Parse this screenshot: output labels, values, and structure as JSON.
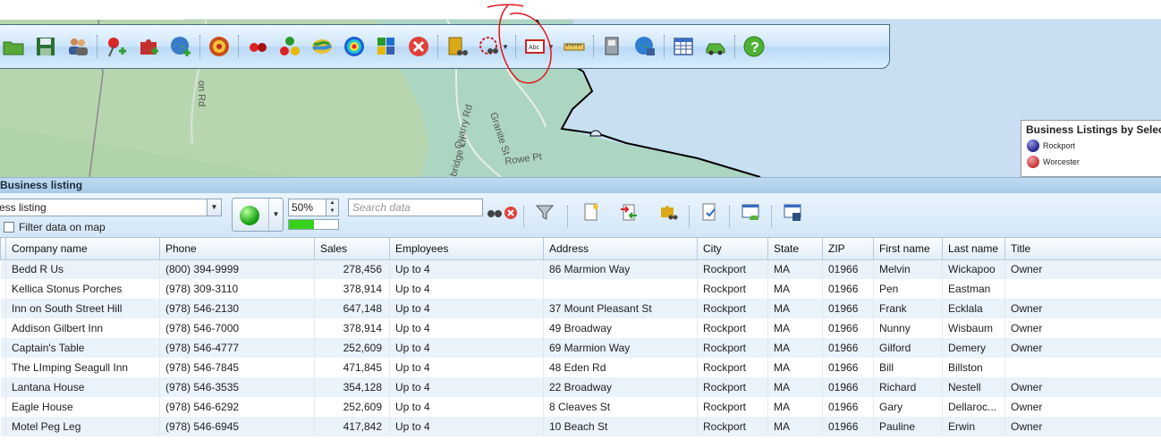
{
  "map": {
    "road_labels": [
      "on Rd",
      "Quarry Rd",
      "Granite St",
      "Rowe Pt",
      "bridge Ln"
    ],
    "colors": {
      "land": "#b5d7b0",
      "water": "#c5ddf0",
      "shore": "#000000"
    }
  },
  "toolbar": {
    "buttons": [
      {
        "name": "open-folder-icon"
      },
      {
        "name": "save-icon"
      },
      {
        "name": "users-icon"
      },
      {
        "name": "add-pushpin-icon"
      },
      {
        "name": "puzzle-add-icon"
      },
      {
        "name": "globe-add-icon"
      },
      {
        "name": "target-icon"
      },
      {
        "name": "dots-red-icon"
      },
      {
        "name": "dots-cluster-icon"
      },
      {
        "name": "shaded-area-icon"
      },
      {
        "name": "heatmap-icon"
      },
      {
        "name": "puzzle-colorful-icon"
      },
      {
        "name": "delete-icon"
      },
      {
        "name": "find-businesses-icon"
      },
      {
        "name": "radius-search-icon"
      },
      {
        "name": "label-icon"
      },
      {
        "name": "ruler-icon"
      },
      {
        "name": "print-icon"
      },
      {
        "name": "globe-export-icon"
      },
      {
        "name": "table-icon"
      },
      {
        "name": "car-icon"
      },
      {
        "name": "help-icon"
      }
    ]
  },
  "legend": {
    "title": "Business Listings by Selec",
    "items": [
      {
        "label": "Rockport",
        "color": "#2a2a8f"
      },
      {
        "label": "Worcester",
        "color": "#c83a3a"
      }
    ]
  },
  "panel": {
    "title": "Business listing",
    "layer_select": "ess listing",
    "filter_label": "Filter data on map",
    "filter_checked": false,
    "color_value": "#22b41e",
    "opacity_label": "50%",
    "opacity_fraction": 0.5,
    "search_placeholder": "Search data"
  },
  "table": {
    "columns": [
      "Company name",
      "Phone",
      "Sales",
      "Employees",
      "Address",
      "City",
      "State",
      "ZIP",
      "First name",
      "Last name",
      "Title"
    ],
    "rows": [
      [
        "Bedd R Us",
        "(800) 394-9999",
        "278,456",
        "Up to 4",
        "86 Marmion Way",
        "Rockport",
        "MA",
        "01966",
        "Melvin",
        "Wickapoo",
        "Owner"
      ],
      [
        "Kellica Stonus Porches",
        "(978) 309-3110",
        "378,914",
        "Up to 4",
        "",
        "Rockport",
        "MA",
        "01966",
        "Pen",
        "Eastman",
        ""
      ],
      [
        "Inn on South Street Hill",
        "(978) 546-2130",
        "647,148",
        "Up to 4",
        "37 Mount Pleasant St",
        "Rockport",
        "MA",
        "01966",
        "Frank",
        "Ecklala",
        "Owner"
      ],
      [
        "Addison Gilbert Inn",
        "(978) 546-7000",
        "378,914",
        "Up to 4",
        "49 Broadway",
        "Rockport",
        "MA",
        "01966",
        "Nunny",
        "Wisbaum",
        "Owner"
      ],
      [
        "Captain's Table",
        "(978) 546-4777",
        "252,609",
        "Up to 4",
        "69 Marmion Way",
        "Rockport",
        "MA",
        "01966",
        "Gilford",
        "Demery",
        "Owner"
      ],
      [
        "The LImping Seagull Inn",
        "(978) 546-7845",
        "471,845",
        "Up to 4",
        "48 Eden Rd",
        "Rockport",
        "MA",
        "01966",
        "Bill",
        "Billston",
        ""
      ],
      [
        "Lantana House",
        "(978) 546-3535",
        "354,128",
        "Up to 4",
        "22 Broadway",
        "Rockport",
        "MA",
        "01966",
        "Richard",
        "Nestell",
        "Owner"
      ],
      [
        "Eagle House",
        "(978) 546-6292",
        "252,609",
        "Up to 4",
        "8 Cleaves St",
        "Rockport",
        "MA",
        "01966",
        "Gary",
        "Dellaroc...",
        "Owner"
      ],
      [
        "Motel Peg Leg",
        "(978) 546-6945",
        "417,842",
        "Up to 4",
        "10 Beach St",
        "Rockport",
        "MA",
        "01966",
        "Pauline",
        "Erwin",
        "Owner"
      ]
    ]
  }
}
